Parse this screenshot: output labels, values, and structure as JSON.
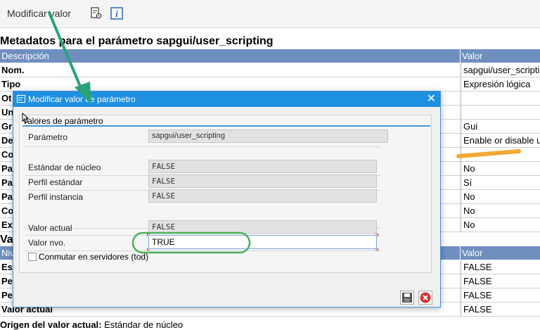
{
  "toolbar": {
    "modify_label": "Modificar valor",
    "icons": [
      "document-settings-icon",
      "info-icon"
    ]
  },
  "page_title": "Metadatos para el parámetro sapgui/user_scripting",
  "metadata_grid": {
    "col_desc": "Descripción",
    "col_value": "Valor",
    "rows": [
      {
        "label": "Nom.",
        "value": "sapgui/user_scripti"
      },
      {
        "label": "Tipo",
        "value": "Expresión lógica"
      },
      {
        "label": "Ot",
        "value": ""
      },
      {
        "label": "Un",
        "value": ""
      },
      {
        "label": "Gr",
        "value": "Gui"
      },
      {
        "label": "De",
        "value": "Enable or disable u"
      },
      {
        "label": "Co",
        "value": ""
      },
      {
        "label": "Pa",
        "value": "No"
      },
      {
        "label": "Pa",
        "value": "Sí"
      },
      {
        "label": "Pa",
        "value": "No"
      },
      {
        "label": "Co",
        "value": "No"
      },
      {
        "label": "Ex",
        "value": "No"
      }
    ]
  },
  "section2_title": "Va",
  "values_grid": {
    "col_desc": "Niv",
    "col_value": "Valor",
    "rows": [
      {
        "label": "Est",
        "value": "FALSE"
      },
      {
        "label": "Per",
        "value": "FALSE"
      },
      {
        "label": "Per",
        "value": "FALSE"
      },
      {
        "label": "Valor actual",
        "value": "FALSE"
      }
    ]
  },
  "footer": {
    "label": "Origen del valor actual:",
    "value": "Estándar de núcleo"
  },
  "dialog": {
    "title": "Modificar valor de parámetro",
    "group_title": "Valores de parámetro",
    "fields": {
      "parametro": {
        "label": "Parámetro",
        "value": "sapgui/user_scripting"
      },
      "estandar_nucleo": {
        "label": "Estándar de núcleo",
        "value": "FALSE"
      },
      "perfil_estandar": {
        "label": "Perfil estándar",
        "value": "FALSE"
      },
      "perfil_instancia": {
        "label": "Perfil instancia",
        "value": "FALSE"
      },
      "valor_actual": {
        "label": "Valor actual",
        "value": "FALSE"
      },
      "valor_nvo": {
        "label": "Valor nvo.",
        "value": "TRUE"
      }
    },
    "checkbox_label": "Conmutar en servidores (tod)",
    "buttons": [
      "save-icon",
      "cancel-icon"
    ]
  },
  "annotation_colors": {
    "arrow": "#2aa37a",
    "highlight_oval": "#4cb05a",
    "marker": "#f0a020",
    "titlebar": "#1e90e0",
    "grid_header": "#6f8fbf"
  }
}
